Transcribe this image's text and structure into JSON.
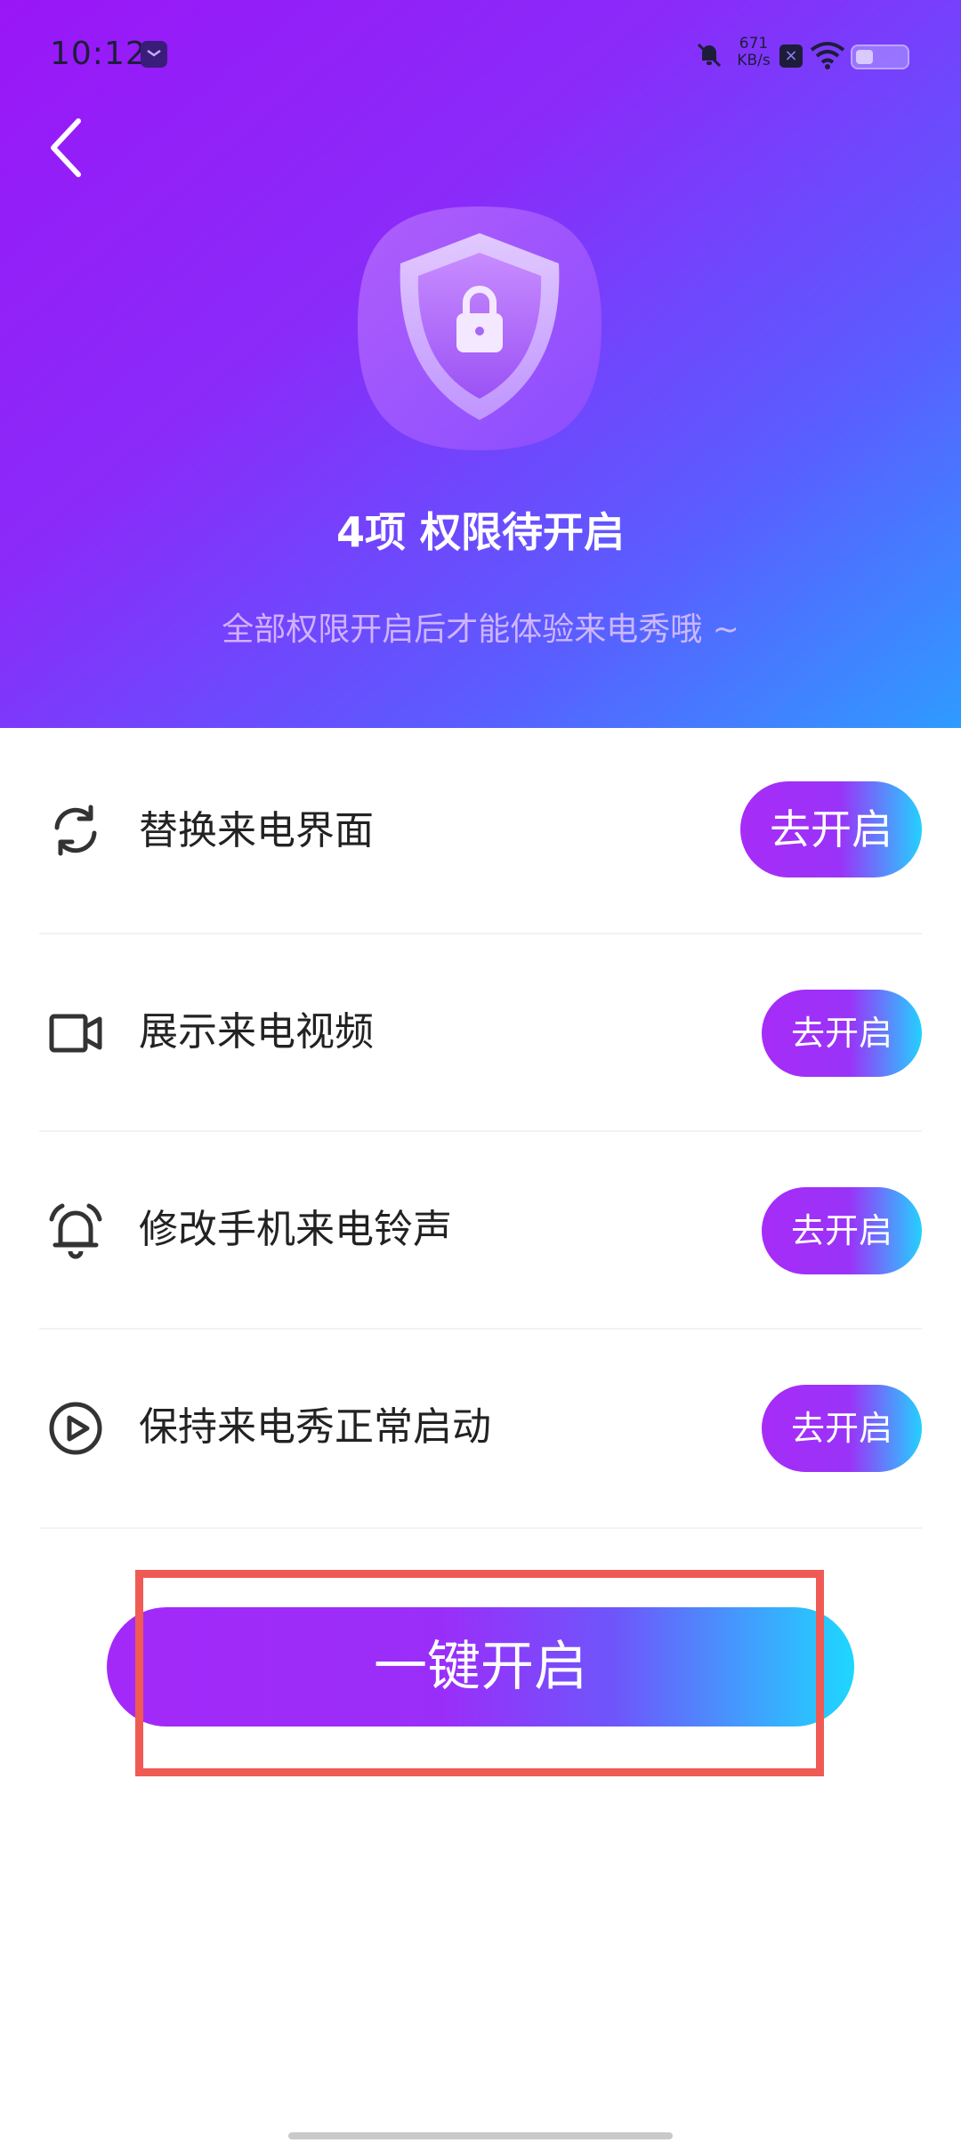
{
  "status_bar": {
    "time": "10:12",
    "net_speed_value": "671",
    "net_speed_unit": "KB/s",
    "battery_fraction": 0.35
  },
  "header": {
    "title": "4项 权限待开启",
    "subtitle": "全部权限开启后才能体验来电秀哦 ~"
  },
  "permissions": [
    {
      "label": "替换来电界面",
      "icon": "refresh-icon",
      "button": "去开启"
    },
    {
      "label": "展示来电视频",
      "icon": "video-camera-icon",
      "button": "去开启"
    },
    {
      "label": "修改手机来电铃声",
      "icon": "alarm-bell-icon",
      "button": "去开启"
    },
    {
      "label": "保持来电秀正常启动",
      "icon": "play-circle-icon",
      "button": "去开启"
    }
  ],
  "cta": {
    "label": "一键开启"
  },
  "colors": {
    "header_gradient_start": "#9a16f7",
    "header_gradient_end": "#2f9bff",
    "button_gradient_start": "#a62cf7",
    "button_gradient_end": "#24d1ff",
    "highlight_box": "#f05a55"
  }
}
